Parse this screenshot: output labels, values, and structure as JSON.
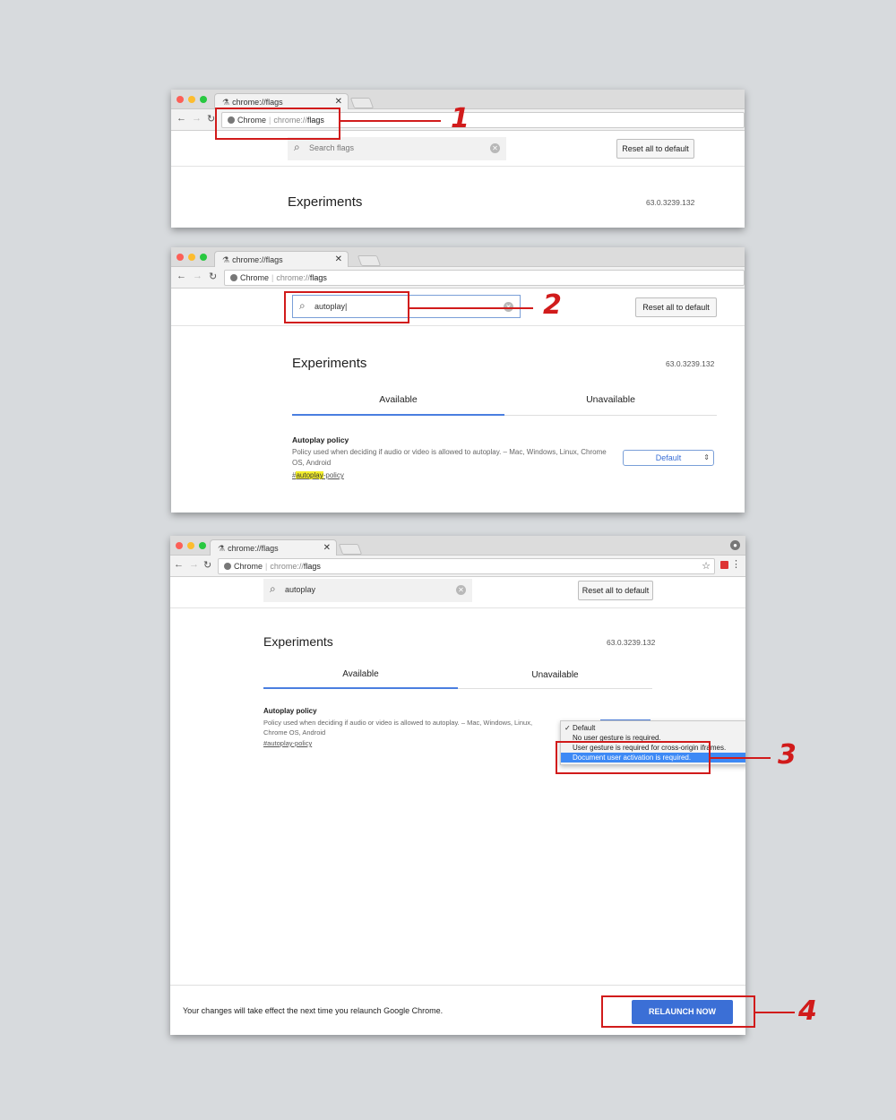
{
  "browser": {
    "tab_title": "chrome://flags",
    "tab_icon": "flask-icon",
    "omnibox_label": "Chrome",
    "url_scheme": "chrome://",
    "url_host": "flags"
  },
  "flags_page": {
    "search_placeholder": "Search flags",
    "search_query": "autoplay",
    "reset_label": "Reset all to default",
    "title": "Experiments",
    "version": "63.0.3239.132",
    "tabs": [
      "Available",
      "Unavailable"
    ]
  },
  "experiment": {
    "name": "Autoplay policy",
    "description": "Policy used when deciding if audio or video is allowed to autoplay. – Mac, Windows, Linux, Chrome OS, Android",
    "link_prefix": "#",
    "link_highlight": "autoplay",
    "link_suffix": "-policy",
    "link_full": "#autoplay-policy",
    "selected_value": "Default",
    "options": [
      "Default",
      "No user gesture is required.",
      "User gesture is required for cross-origin iframes.",
      "Document user activation is required."
    ],
    "highlighted_option": "Document user activation is required."
  },
  "footer": {
    "message": "Your changes will take effect the next time you relaunch Google Chrome.",
    "relaunch_label": "RELAUNCH NOW"
  },
  "steps": [
    "1",
    "2",
    "3",
    "4"
  ],
  "colors": {
    "callout_red": "#d11b1b",
    "accent_blue": "#3b6fd6",
    "highlight_yellow": "#f5f02c"
  }
}
